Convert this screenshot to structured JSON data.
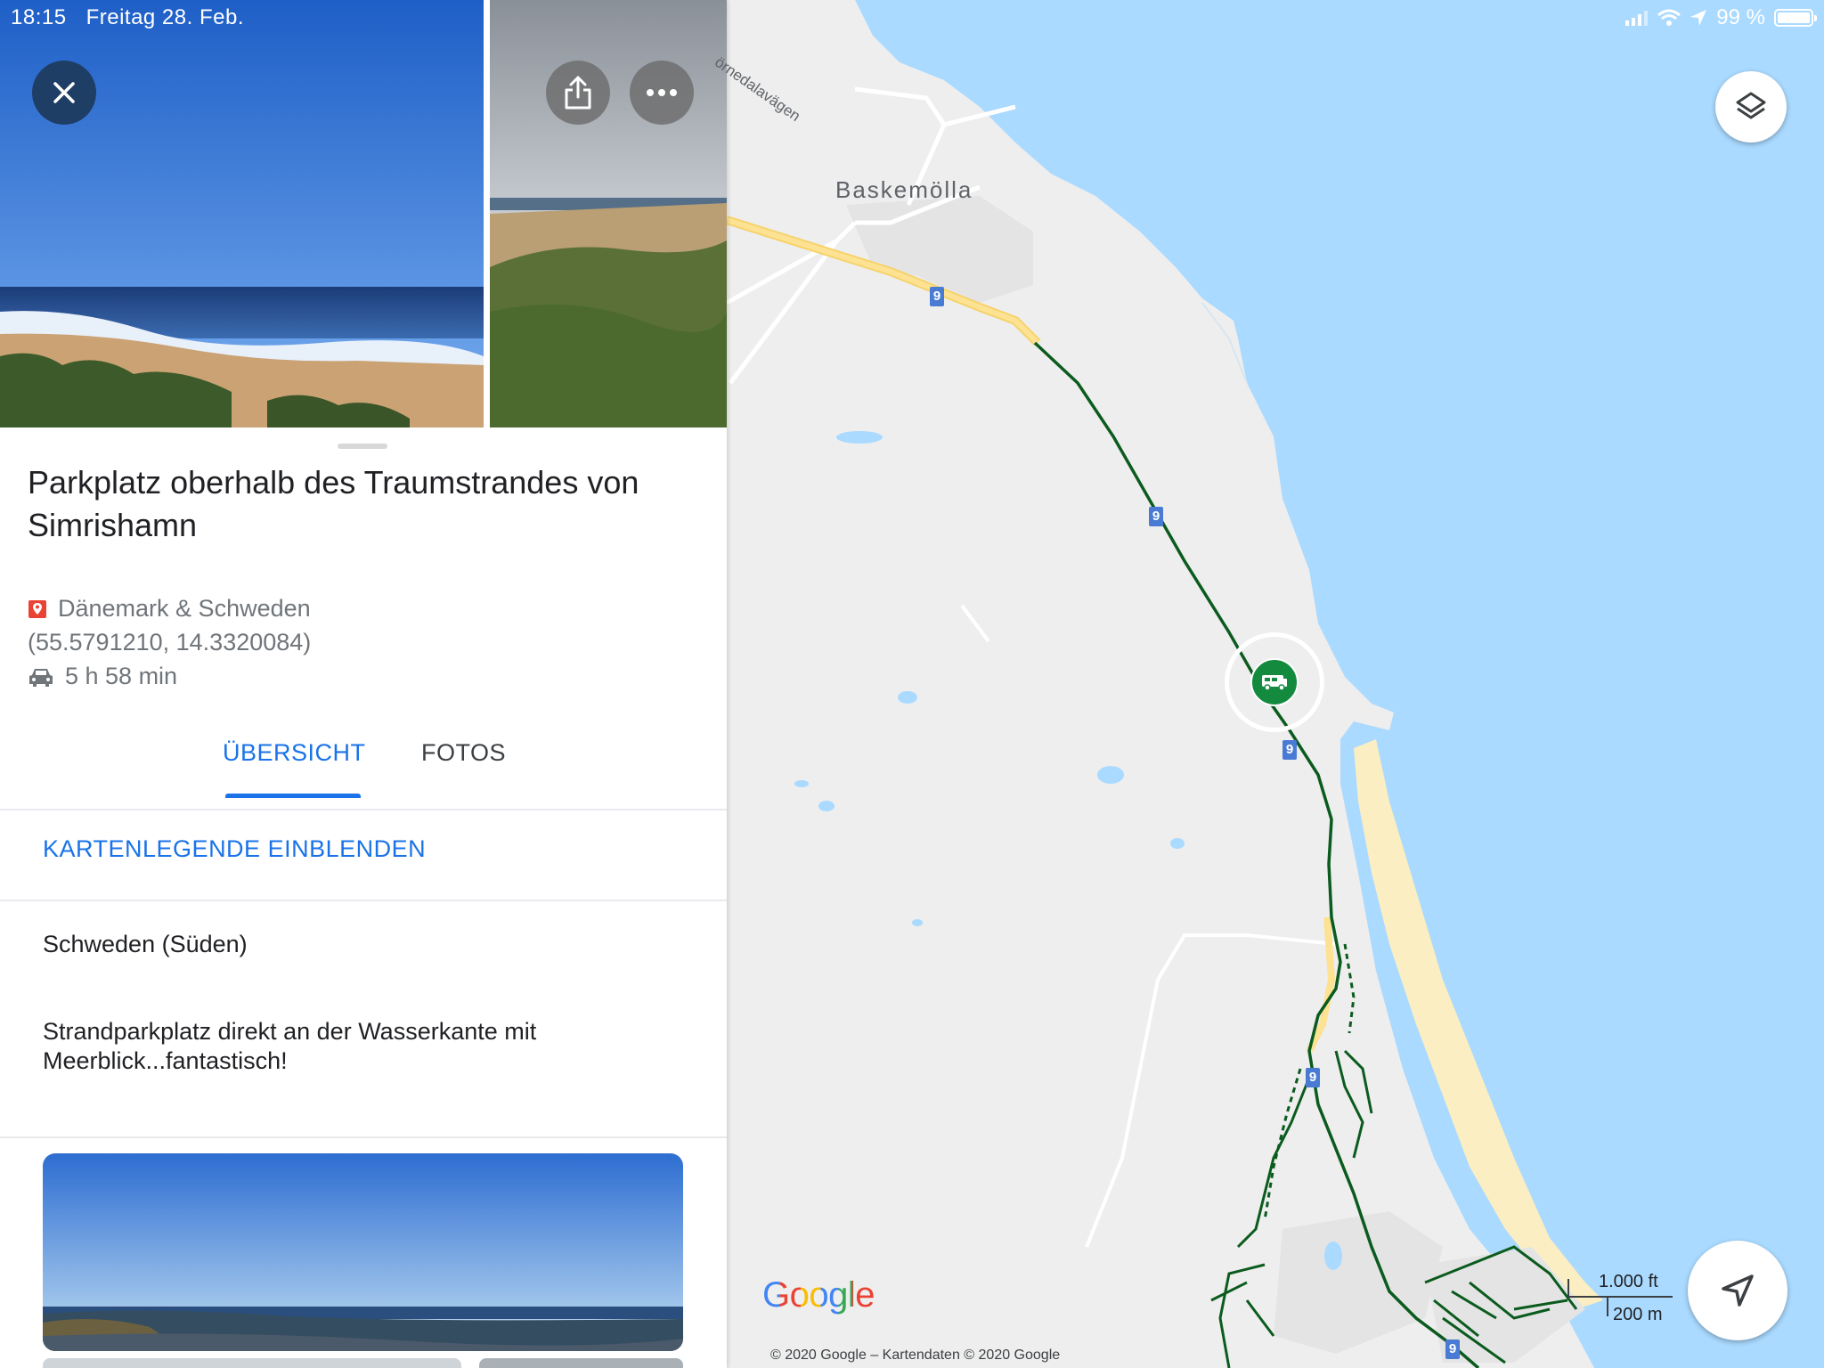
{
  "status_bar": {
    "time": "18:15",
    "date": "Freitag 28. Feb.",
    "battery": "99 %",
    "battery_level": 0.99
  },
  "place": {
    "title": "Parkplatz oberhalb des Traumstrandes von Simrishamn",
    "category": "Dänemark & Schweden",
    "coordinates": "(55.5791210, 14.3320084)",
    "drive_time": "5 h 58 min"
  },
  "tabs": [
    {
      "label": "ÜBERSICHT",
      "active": true
    },
    {
      "label": "FOTOS",
      "active": false
    }
  ],
  "legend_link": "KARTENLEGENDE EINBLENDEN",
  "region": "Schweden (Süden)",
  "description": "Strandparkplatz direkt an der Wasserkante mit Meerblick...fantastisch!",
  "map": {
    "town_label": "Baskemölla",
    "road_label": "örnedalavägen",
    "road_badge": "9",
    "google_logo": "Google",
    "copyright": "© 2020 Google – Kartendaten © 2020 Google",
    "scale_imperial": "1.000 ft",
    "scale_metric": "200 m"
  },
  "icons": {
    "close": "close-icon",
    "share": "share-icon",
    "more": "more-icon",
    "pin": "map-pin-icon",
    "car": "car-icon",
    "layers": "layers-icon",
    "navigate": "navigation-arrow-icon",
    "camper": "camper-van-icon"
  },
  "colors": {
    "accent": "#1a73e8",
    "pin_red": "#ea4335",
    "route_green": "#0b5b1e",
    "marker_green": "#138a3e",
    "water": "#aadaff",
    "beach": "#fbeec2",
    "land": "#eeeeee"
  }
}
